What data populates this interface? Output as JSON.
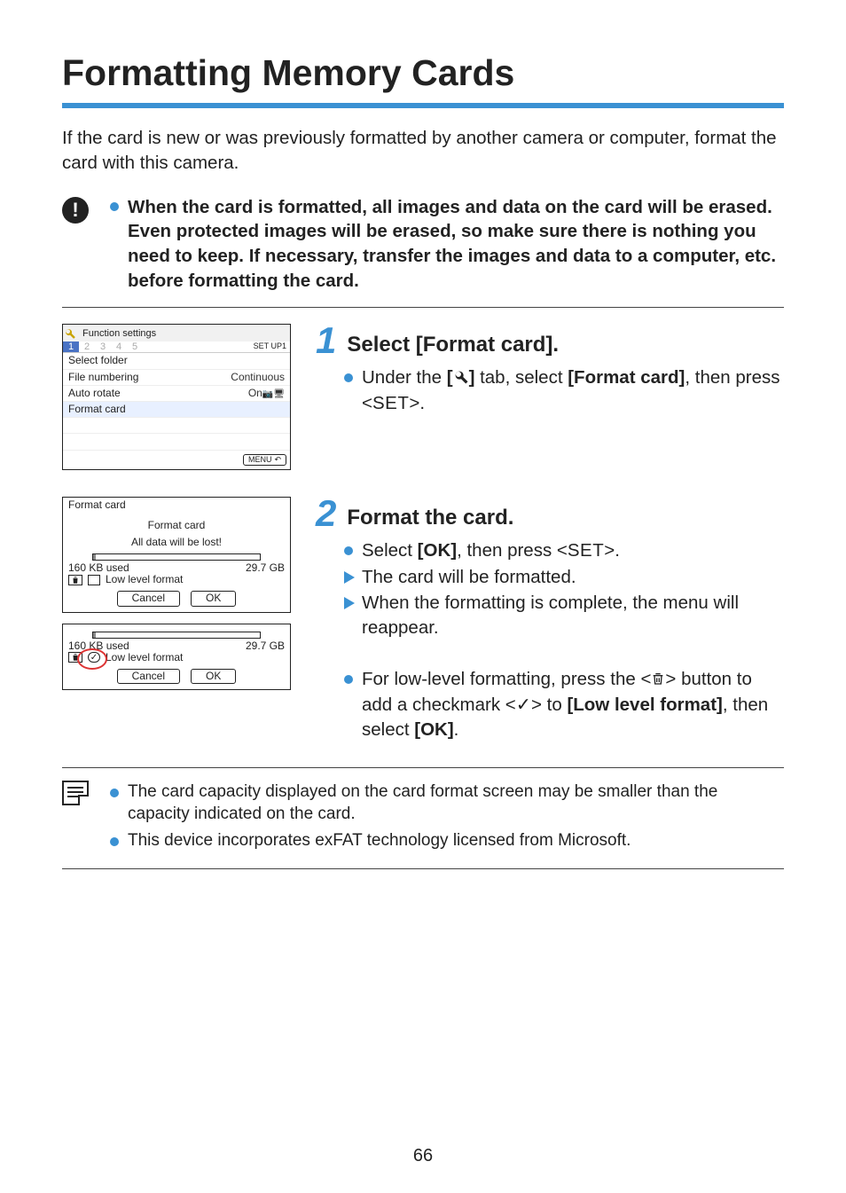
{
  "page": {
    "title": "Formatting Memory Cards",
    "intro": "If the card is new or was previously formatted by another camera or computer, format the card with this camera.",
    "page_number": "66"
  },
  "warning": {
    "text": "When the card is formatted, all images and data on the card will be erased. Even protected images will be erased, so make sure there is nothing you need to keep. If necessary, transfer the images and data to a computer, etc. before formatting the card."
  },
  "shot1": {
    "tabbar_title": "Function settings",
    "setup_label": "SET UP1",
    "tabs": [
      "1",
      "2",
      "3",
      "4",
      "5"
    ],
    "items": {
      "select_folder": "Select folder",
      "file_numbering": "File numbering",
      "file_numbering_val": "Continuous",
      "auto_rotate": "Auto rotate",
      "auto_rotate_val": "On",
      "format_card": "Format card"
    },
    "menu_btn": "MENU"
  },
  "shot2": {
    "header": "Format card",
    "line1": "Format card",
    "line2": "All data will be lost!",
    "used": "160 KB used",
    "total": "29.7 GB",
    "llf": "Low level format",
    "cancel": "Cancel",
    "ok": "OK"
  },
  "shot3": {
    "used": "160 KB used",
    "total": "29.7 GB",
    "llf": "Low level format",
    "cancel": "Cancel",
    "ok": "OK"
  },
  "step1": {
    "num": "1",
    "title": "Select [Format card].",
    "line1_pre": "Under the ",
    "line1_tab": "[",
    "line1_tab_close": "]",
    "line1_mid": " tab, select ",
    "line1_bold": "[Format card]",
    "line1_post": ", then press <",
    "line1_set": "SET",
    "line1_end": ">."
  },
  "step2": {
    "num": "2",
    "title": "Format the card.",
    "l1_pre": "Select ",
    "l1_bold": "[OK]",
    "l1_mid": ", then press <",
    "l1_set": "SET",
    "l1_end": ">.",
    "l2": "The card will be formatted.",
    "l3": "When the formatting is complete, the menu will reappear.",
    "l4_pre": "For low-level formatting, press the <",
    "l4_mid": "> button to add a checkmark <",
    "l4_mid2": "> to ",
    "l4_bold1": "[Low level format]",
    "l4_mid3": ", then select ",
    "l4_bold2": "[OK]",
    "l4_end": "."
  },
  "notes": {
    "n1": "The card capacity displayed on the card format screen may be smaller than the capacity indicated on the card.",
    "n2": "This device incorporates exFAT technology licensed from Microsoft."
  },
  "icons": {
    "wrench": "wrench-icon",
    "camera": "camera-icon",
    "monitor": "monitor-icon",
    "trash": "trash-icon",
    "check": "✓",
    "back": "↶"
  }
}
